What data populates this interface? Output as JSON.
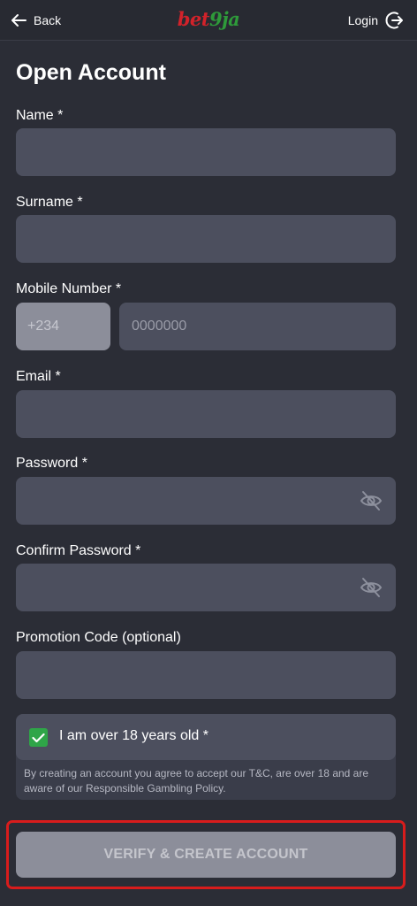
{
  "header": {
    "back_label": "Back",
    "logo_part1": "bet",
    "logo_part2": "9ja",
    "login_label": "Login"
  },
  "form": {
    "title": "Open Account",
    "name_label": "Name *",
    "name_value": "",
    "surname_label": "Surname *",
    "surname_value": "",
    "mobile_label": "Mobile Number *",
    "country_code": "+234",
    "mobile_placeholder": "0000000",
    "email_label": "Email *",
    "email_value": "",
    "password_label": "Password *",
    "password_value": "",
    "confirm_password_label": "Confirm Password *",
    "confirm_password_value": "",
    "promo_label": "Promotion Code (optional)",
    "promo_value": "",
    "age_label": "I am over 18 years old *",
    "age_checked": true,
    "disclaimer": "By creating an account you agree to accept our T&C, are over 18 and are aware of our Responsible Gambling Policy.",
    "submit_label": "VERIFY & CREATE ACCOUNT"
  },
  "colors": {
    "background": "#2b2d36",
    "input_bg": "#4c4f5e",
    "accent_green": "#2fa548",
    "highlight_red": "#d81c1c",
    "logo_red": "#d2222a",
    "logo_green": "#2e9a3a",
    "disabled_button": "#8c8e9a"
  },
  "icons": {
    "back": "arrow-left-icon",
    "login": "login-arrow-circle-icon",
    "password_toggle": "eye-slash-icon",
    "checkbox": "check-icon"
  }
}
